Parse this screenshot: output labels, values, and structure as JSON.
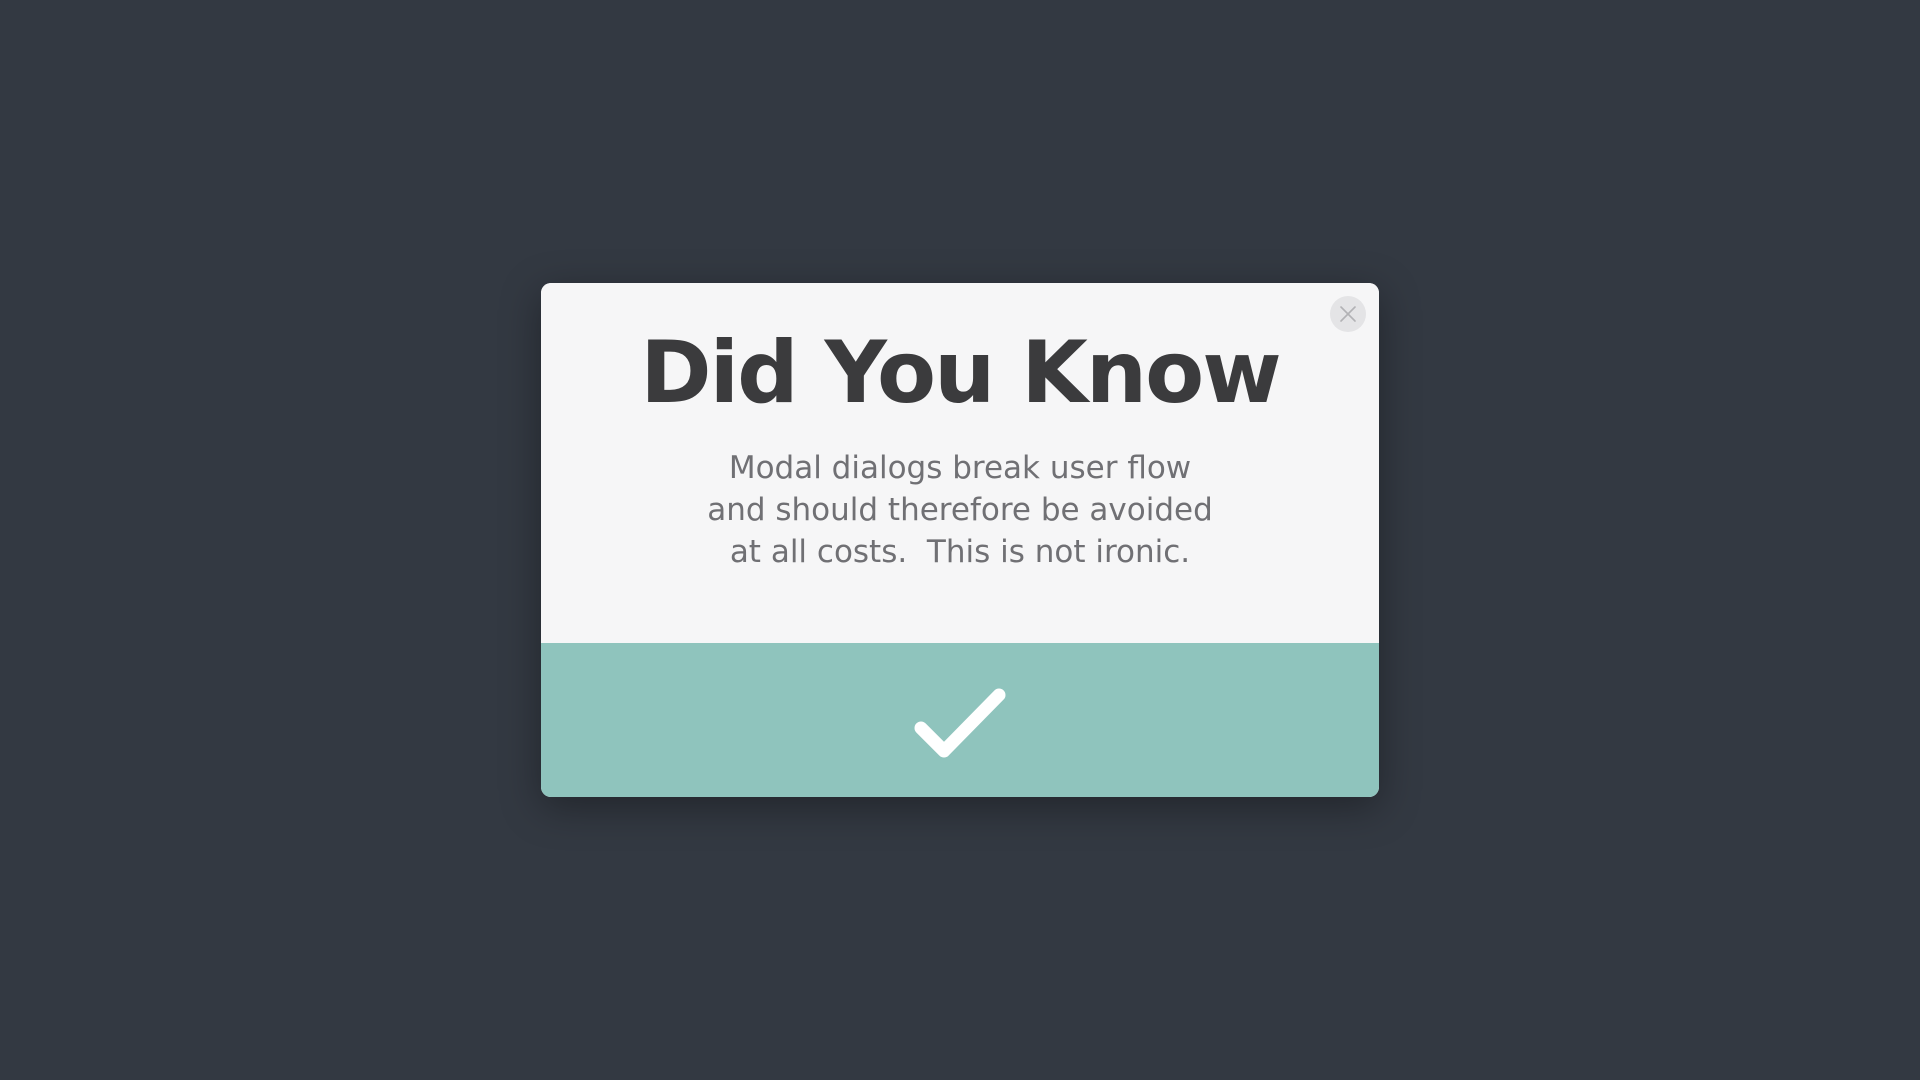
{
  "modal": {
    "title": "Did You Know",
    "message_lines": [
      "Modal dialogs break user flow",
      "and should therefore be avoided",
      "at all costs.  This is not ironic."
    ],
    "close_icon": "close-icon",
    "confirm_icon": "checkmark-icon"
  },
  "colors": {
    "backdrop": "#333942",
    "modal_background": "#f6f6f7",
    "confirm_bar": "#8fc4bd",
    "title_text": "#3b3b3d",
    "message_text": "#707074"
  }
}
